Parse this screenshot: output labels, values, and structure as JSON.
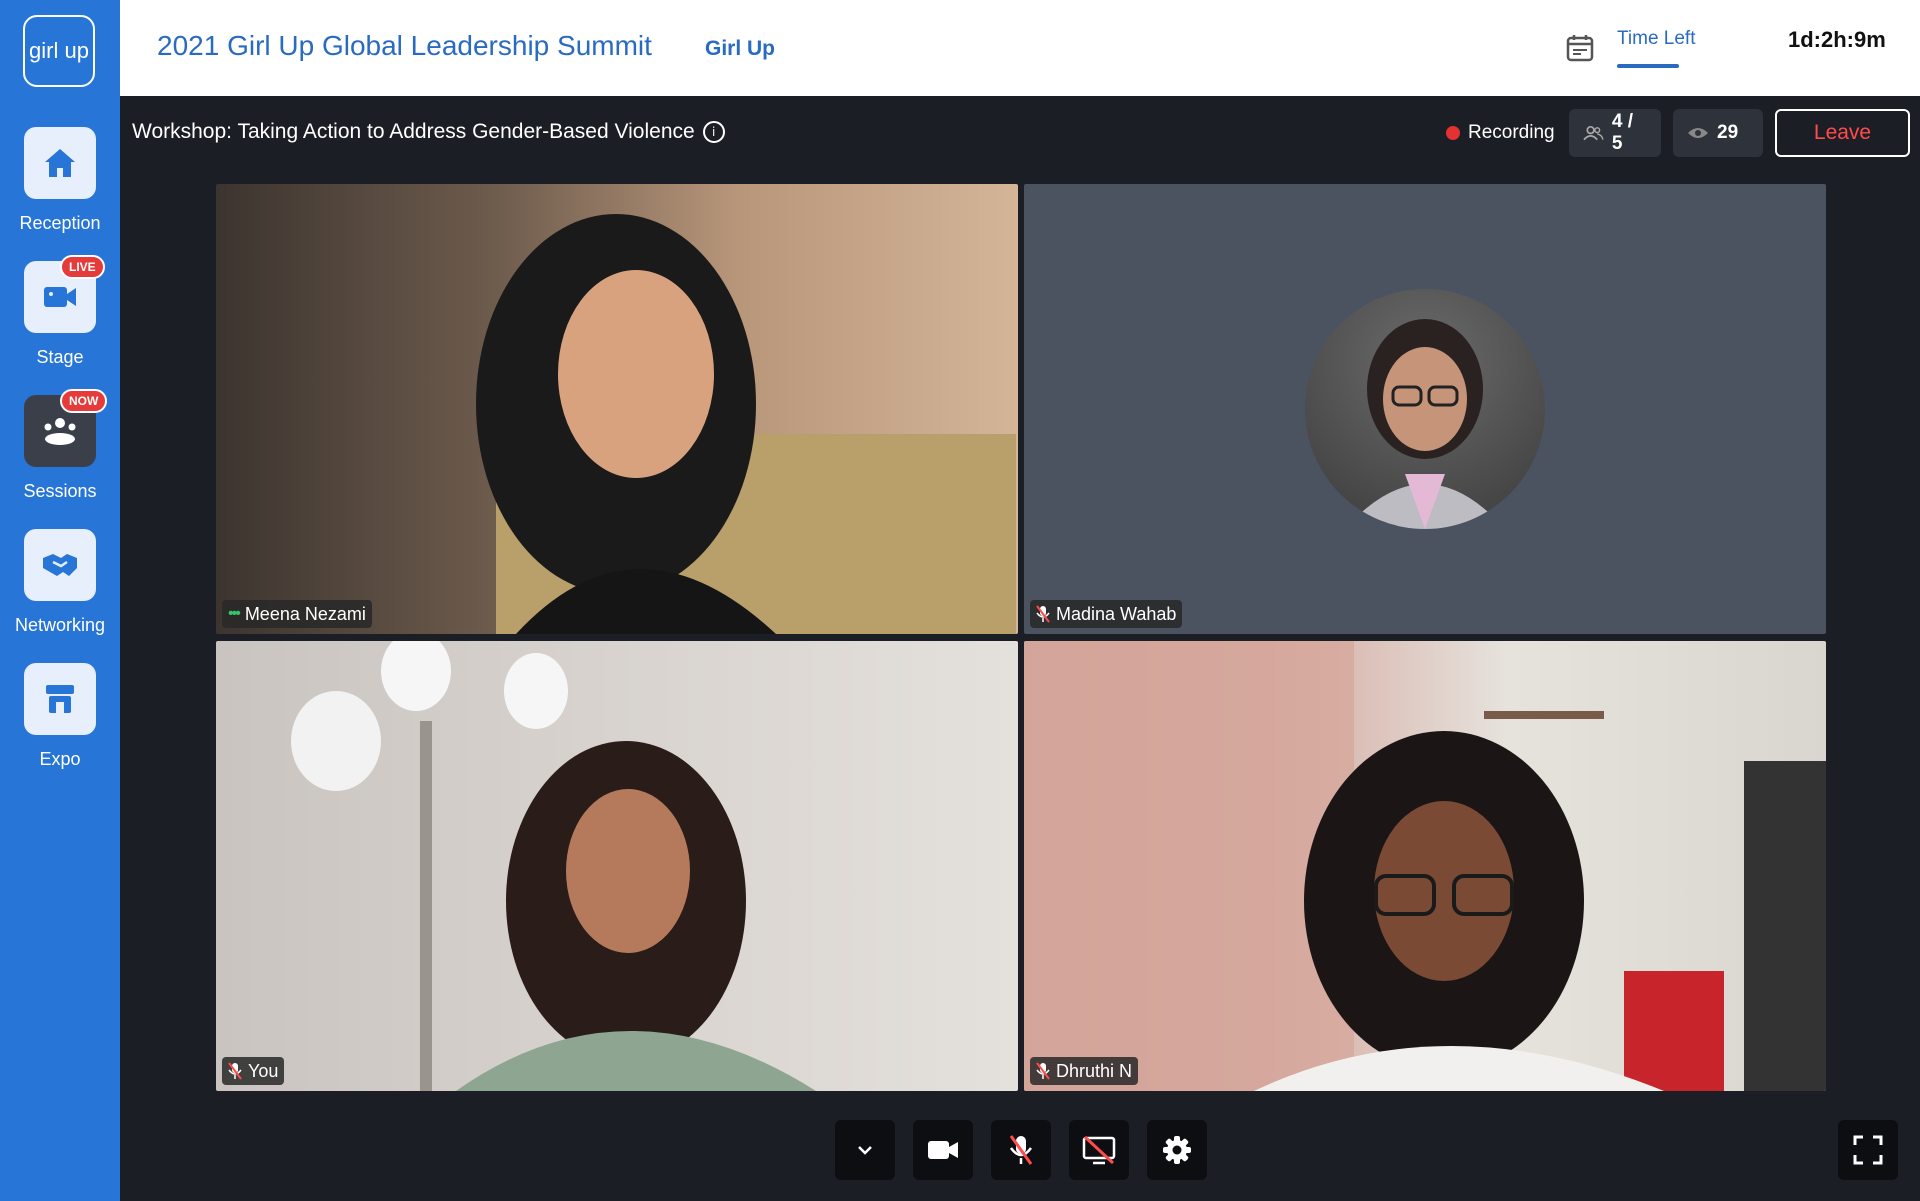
{
  "sidebar": {
    "logo_text": "girl up",
    "items": [
      {
        "label": "Reception",
        "badge": ""
      },
      {
        "label": "Stage",
        "badge": "LIVE"
      },
      {
        "label": "Sessions",
        "badge": "NOW"
      },
      {
        "label": "Networking",
        "badge": ""
      },
      {
        "label": "Expo",
        "badge": ""
      }
    ]
  },
  "header": {
    "event_title": "2021 Girl Up Global Leadership Summit",
    "org_name": "Girl Up",
    "time_left_label": "Time Left",
    "time_left_value": "1d:2h:9m"
  },
  "session": {
    "title": "Workshop: Taking Action to Address Gender-Based Violence",
    "recording_label": "Recording",
    "participants": "4 / 5",
    "viewers": "29",
    "leave_label": "Leave"
  },
  "participants": [
    {
      "name": "Meena Nezami",
      "status": "speaking"
    },
    {
      "name": "Madina Wahab",
      "status": "muted"
    },
    {
      "name": "You",
      "status": "muted"
    },
    {
      "name": "Dhruthi N",
      "status": "muted"
    }
  ],
  "colors": {
    "brand": "#2775d6",
    "accent_text": "#2a6bc2",
    "leave": "#ff4b4b",
    "recording": "#e23232"
  }
}
